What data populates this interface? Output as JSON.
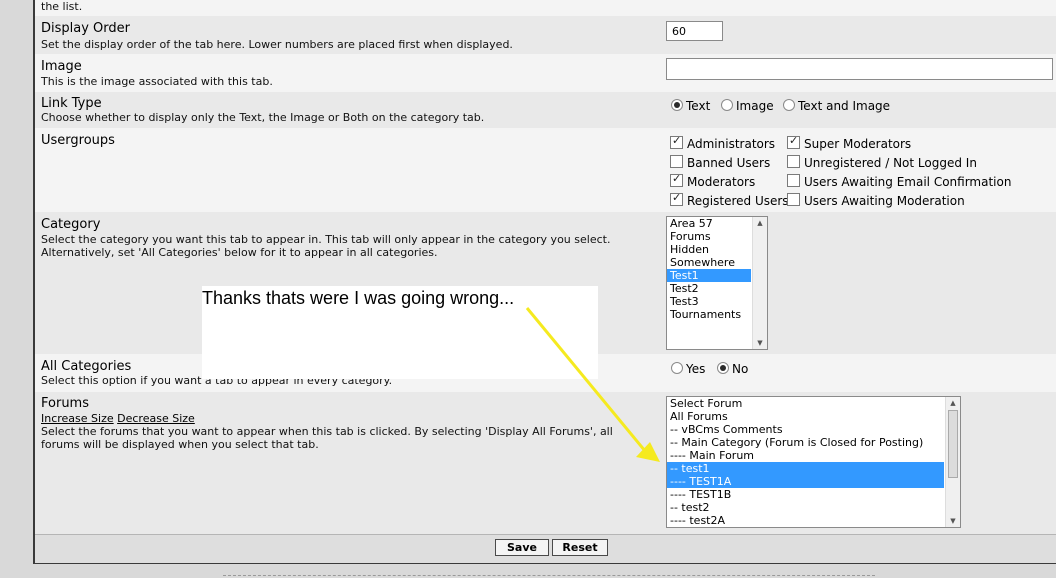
{
  "top_fragment": "the list.",
  "display_order": {
    "title": "Display Order",
    "desc": "Set the display order of the tab here. Lower numbers are placed first when displayed.",
    "value": "60"
  },
  "image": {
    "title": "Image",
    "desc": "This is the image associated with this tab.",
    "value": ""
  },
  "link_type": {
    "title": "Link Type",
    "desc": "Choose whether to display only the Text, the Image or Both on the category tab.",
    "options": [
      "Text",
      "Image",
      "Text and Image"
    ],
    "selected": "Text"
  },
  "usergroups": {
    "title": "Usergroups",
    "items": [
      {
        "label": "Administrators",
        "checked": true
      },
      {
        "label": "Super Moderators",
        "checked": true
      },
      {
        "label": "Banned Users",
        "checked": false
      },
      {
        "label": "Unregistered / Not Logged In",
        "checked": false
      },
      {
        "label": "Moderators",
        "checked": true
      },
      {
        "label": "Users Awaiting Email Confirmation",
        "checked": false
      },
      {
        "label": "Registered Users",
        "checked": true
      },
      {
        "label": "Users Awaiting Moderation",
        "checked": false
      }
    ]
  },
  "category": {
    "title": "Category",
    "desc1": "Select the category you want this tab to appear in. This tab will only appear in the category you select.",
    "desc2": "Alternatively, set 'All Categories' below for it to appear in all categories.",
    "options": [
      "Area 57",
      "Forums",
      "Hidden",
      "Somewhere",
      "Test1",
      "Test2",
      "Test3",
      "Tournaments"
    ],
    "selected": "Test1"
  },
  "all_categories": {
    "title": "All Categories",
    "desc": "Select this option if you want a tab to appear in every category.",
    "options": [
      "Yes",
      "No"
    ],
    "selected": "No"
  },
  "forums": {
    "title": "Forums",
    "increase": "Increase Size",
    "decrease": "Decrease Size",
    "desc1": "Select the forums that you want to appear when this tab is clicked. By selecting 'Display All Forums', all",
    "desc2": "forums will be displayed when you select that tab.",
    "options": [
      "Select Forum",
      "All Forums",
      "-- vBCms Comments",
      "-- Main Category (Forum is Closed for Posting)",
      "---- Main Forum",
      "-- test1",
      "---- TEST1A",
      "---- TEST1B",
      "-- test2",
      "---- test2A"
    ],
    "selected": [
      "-- test1",
      "---- TEST1A"
    ]
  },
  "buttons": {
    "save": "Save",
    "reset": "Reset"
  },
  "annotation": {
    "text": "Thanks thats were I was going wrong...",
    "arrow_color": "#f5ea1f"
  }
}
